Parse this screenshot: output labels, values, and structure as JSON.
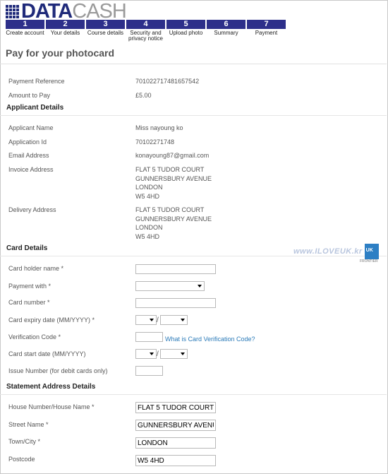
{
  "brand": {
    "word1": "DATA",
    "word2": "CASH"
  },
  "steps": [
    {
      "num": "1",
      "label": "Create account"
    },
    {
      "num": "2",
      "label": "Your details"
    },
    {
      "num": "3",
      "label": "Course details"
    },
    {
      "num": "4",
      "label": "Security and privacy notice"
    },
    {
      "num": "5",
      "label": "Upload photo"
    },
    {
      "num": "6",
      "label": "Summary"
    },
    {
      "num": "7",
      "label": "Payment"
    }
  ],
  "page_title": "Pay for your photocard",
  "payment": {
    "reference_label": "Payment Reference",
    "reference_value": "701022717481657542",
    "amount_label": "Amount to Pay",
    "amount_value": "£5.00"
  },
  "applicant": {
    "heading": "Applicant Details",
    "name_label": "Applicant Name",
    "name_value": "Miss nayoung ko",
    "id_label": "Application Id",
    "id_value": "70102271748",
    "email_label": "Email Address",
    "email_value": "konayoung87@gmail.com",
    "invoice_label": "Invoice Address",
    "invoice_value": "FLAT 5 TUDOR COURT\nGUNNERSBURY AVENUE\nLONDON\nW5 4HD",
    "delivery_label": "Delivery Address",
    "delivery_value": "FLAT 5 TUDOR COURT\nGUNNERSBURY AVENUE\nLONDON\nW5 4HD"
  },
  "card": {
    "heading": "Card Details",
    "holder_label": "Card holder name *",
    "holder_value": "",
    "payment_with_label": "Payment with *",
    "payment_with_value": "",
    "number_label": "Card number *",
    "number_value": "",
    "expiry_label": "Card expiry date (MM/YYYY) *",
    "cvc_label": "Verification Code *",
    "cvc_value": "",
    "cvc_link": "What is Card Verification Code?",
    "start_label": "Card start date (MM/YYYY)",
    "issue_label": "Issue Number (for debit cards only)",
    "issue_value": "",
    "date_separator": "/"
  },
  "statement": {
    "heading": "Statement Address Details",
    "house_label": "House Number/House Name *",
    "house_value": "FLAT 5 TUDOR COURT",
    "street_label": "Street Name *",
    "street_value": "GUNNERSBURY AVENU",
    "town_label": "Town/City *",
    "town_value": "LONDON",
    "postcode_label": "Postcode",
    "postcode_value": "W5 4HD"
  },
  "watermark": {
    "text": "www.ILOVEUK.kr",
    "badge": "UK",
    "badge_sub": "FRONTIER"
  },
  "colors": {
    "brand_navy": "#1f2a7a",
    "step_bg": "#2d2f8a",
    "link": "#2a7ab8"
  }
}
